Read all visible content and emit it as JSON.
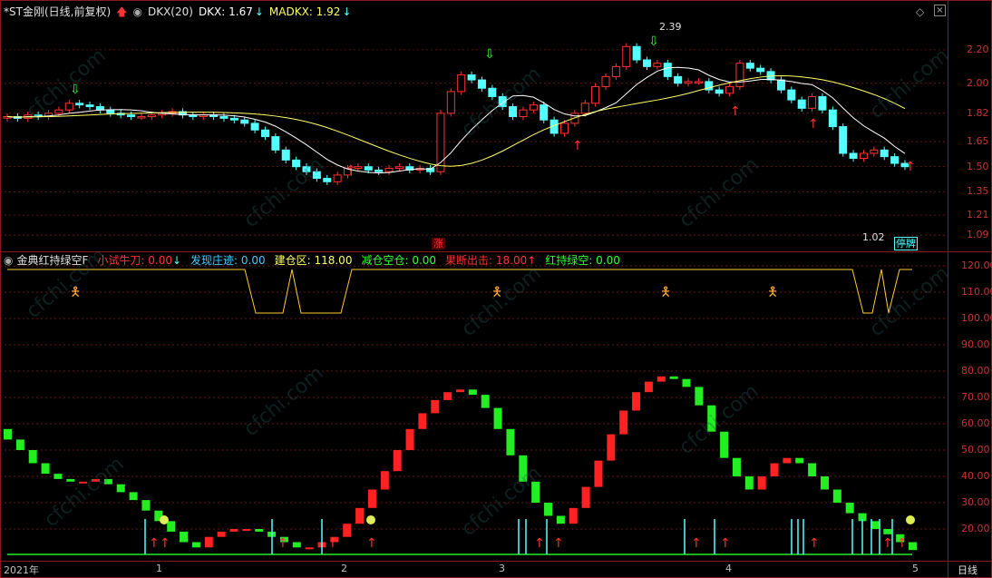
{
  "main": {
    "title": "*ST金刚(日线,前复权)",
    "indicator_name": "DKX(20)",
    "dkx_label": "DKX: 1.67",
    "madkx_label": "MADKX: 1.92",
    "high_label": "2.39",
    "low_label": "1.02",
    "badge_tingpai": "停牌",
    "badge_zhang": "涨",
    "price_ticks": [
      "2.20",
      "2.00",
      "1.82",
      "1.65",
      "1.50",
      "1.35",
      "1.21",
      "1.09"
    ]
  },
  "sub": {
    "title": "金典红持绿空F",
    "items": [
      {
        "label": "小试牛刀: 0.00",
        "color": "#ff3333"
      },
      {
        "label": "发现庄迹: 0.00",
        "color": "#44ccff"
      },
      {
        "label": "建仓区: 118.00",
        "color": "#ffff66"
      },
      {
        "label": "减仓空仓: 0.00",
        "color": "#33ff33"
      },
      {
        "label": "果断出击: 18.00",
        "color": "#ff3333"
      },
      {
        "label": "红持绿空: 0.00",
        "color": "#33ff33"
      }
    ],
    "ticks": [
      "120.00",
      "110.00",
      "100.00",
      "90.00",
      "80.00",
      "70.00",
      "60.00",
      "50.00",
      "40.00",
      "30.00",
      "20.00"
    ]
  },
  "xaxis": {
    "labels": [
      "2021年",
      "1",
      "2",
      "3",
      "4",
      "5"
    ],
    "period": "日线"
  },
  "colors": {
    "up": "#ff3333",
    "down": "#54ffff",
    "dkx": "#ffffff",
    "madkx": "#ffff66",
    "grid": "#8a1a1a"
  },
  "chart_data": [
    {
      "type": "candlestick",
      "title": "*ST金刚(日线,前复权)",
      "ylim": [
        1.02,
        2.39
      ],
      "close": [
        1.8,
        1.79,
        1.81,
        1.8,
        1.82,
        1.84,
        1.88,
        1.87,
        1.86,
        1.84,
        1.82,
        1.81,
        1.8,
        1.8,
        1.81,
        1.82,
        1.83,
        1.81,
        1.8,
        1.81,
        1.8,
        1.79,
        1.78,
        1.76,
        1.72,
        1.68,
        1.6,
        1.54,
        1.5,
        1.47,
        1.43,
        1.41,
        1.45,
        1.49,
        1.5,
        1.48,
        1.47,
        1.49,
        1.5,
        1.48,
        1.49,
        1.47,
        1.82,
        1.95,
        2.05,
        2.02,
        1.97,
        1.92,
        1.86,
        1.8,
        1.84,
        1.87,
        1.78,
        1.7,
        1.76,
        1.82,
        1.88,
        1.98,
        2.04,
        2.1,
        2.22,
        2.14,
        2.1,
        2.12,
        2.04,
        2.0,
        2.01,
        2.01,
        1.96,
        1.94,
        1.98,
        2.12,
        2.09,
        2.07,
        2.02,
        1.96,
        1.9,
        1.85,
        1.92,
        1.84,
        1.74,
        1.58,
        1.55,
        1.58,
        1.6,
        1.56,
        1.52,
        1.5
      ]
    },
    {
      "type": "bar",
      "title": "金典红持绿空F",
      "ylim": [
        10,
        120
      ],
      "values": [
        54,
        50,
        45,
        41,
        39,
        38,
        38,
        39,
        37,
        34,
        31,
        27,
        23,
        19,
        15,
        13,
        17,
        19,
        20,
        20,
        19,
        17,
        15,
        13,
        13,
        15,
        17,
        22,
        28,
        35,
        42,
        50,
        58,
        64,
        69,
        72,
        73,
        71,
        66,
        58,
        48,
        38,
        30,
        25,
        22,
        28,
        36,
        46,
        56,
        65,
        72,
        76,
        78,
        77,
        74,
        67,
        57,
        47,
        40,
        35,
        40,
        45,
        47,
        45,
        40,
        35,
        30,
        26,
        23,
        20,
        18,
        15,
        12
      ]
    }
  ]
}
